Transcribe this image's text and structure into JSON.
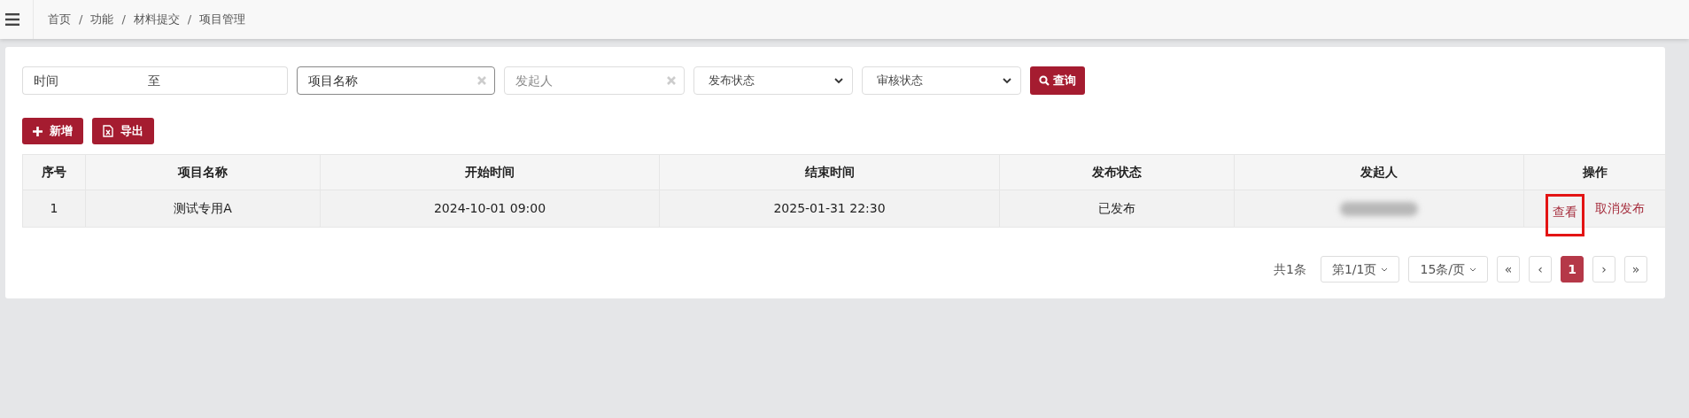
{
  "breadcrumb": [
    "首页",
    "功能",
    "材料提交",
    "项目管理"
  ],
  "breadcrumb_separator": "/",
  "filters": {
    "time_start": {
      "placeholder": "时间"
    },
    "time_end": {
      "placeholder": "至"
    },
    "fields": [
      {
        "placeholder": "项目名称",
        "focused": true
      },
      {
        "placeholder": "发起人",
        "focused": false
      }
    ],
    "selects": [
      {
        "value": "发布状态"
      },
      {
        "value": "审核状态"
      }
    ],
    "search_button": "查询"
  },
  "actions": [
    {
      "kind": "add",
      "label": "新增"
    },
    {
      "kind": "export",
      "label": "导出"
    }
  ],
  "table": {
    "columns": [
      "序号",
      "项目名称",
      "开始时间",
      "结束时间",
      "发布状态",
      "发起人",
      "操作"
    ],
    "rows": [
      {
        "cells": [
          "1",
          "测试专用A",
          "2024-10-01 09:00",
          "2025-01-31 22:30",
          "已发布"
        ],
        "initiator_redacted": true,
        "ops": [
          {
            "label": "查看",
            "highlighted": true
          },
          {
            "label": "取消发布",
            "highlighted": false
          }
        ]
      }
    ]
  },
  "pagination": {
    "total": "共1条",
    "page_select": "第1/1页",
    "size_select": "15条/页",
    "first": "«",
    "prev": "‹",
    "pages": [
      {
        "label": "1",
        "selected": true
      }
    ],
    "next": "›",
    "last": "»"
  }
}
